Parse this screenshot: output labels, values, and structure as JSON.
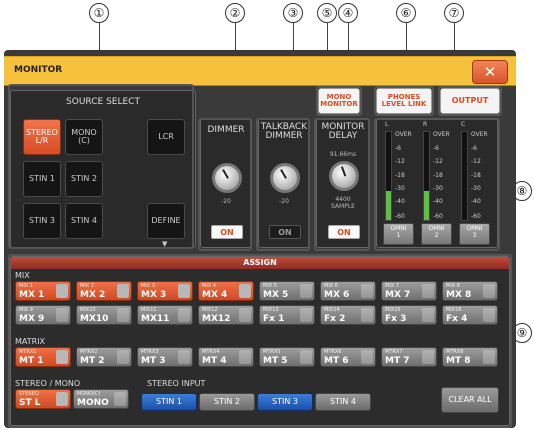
{
  "callouts": [
    "①",
    "②",
    "③",
    "⑤",
    "④",
    "⑥",
    "⑦",
    "⑧",
    "⑨"
  ],
  "window": {
    "title": "MONITOR",
    "close_symbol": "✕"
  },
  "source_select": {
    "title": "SOURCE SELECT",
    "buttons": [
      {
        "label": "STEREO L/R",
        "state": "on"
      },
      {
        "label": "MONO (C)",
        "state": "off"
      },
      {
        "label": "LCR",
        "state": "off"
      },
      {
        "label": "STIN 1",
        "state": "off"
      },
      {
        "label": "STIN 2",
        "state": "off"
      },
      {
        "label": "STIN 3",
        "state": "off"
      },
      {
        "label": "STIN 4",
        "state": "off"
      },
      {
        "label": "DEFINE",
        "state": "off"
      }
    ]
  },
  "dimmer": {
    "title": "DIMMER",
    "value": "-20",
    "on_label": "ON",
    "on": true
  },
  "talkback_dimmer": {
    "title": "TALKBACK DIMMER",
    "value": "-20",
    "on_label": "ON",
    "on": false
  },
  "monitor_delay": {
    "title": "MONITOR DELAY",
    "time": "91.66ms",
    "samples": "4400",
    "sample_unit": "SAMPLE",
    "on_label": "ON",
    "on": true
  },
  "top_buttons": {
    "mono_monitor": "MONO MONITOR",
    "phones_level_link": "PHONES LEVEL LINK",
    "output": "OUTPUT"
  },
  "meters": {
    "scale": [
      "OVER",
      "-6",
      "-12",
      "-18",
      "-30",
      "-40",
      "-60"
    ],
    "channels": [
      {
        "head": "L",
        "level": 0.33,
        "omni": "OMNI",
        "omni_num": "1"
      },
      {
        "head": "R",
        "level": 0.33,
        "omni": "OMNI",
        "omni_num": "2"
      },
      {
        "head": "C",
        "level": 0.0,
        "omni": "OMNI",
        "omni_num": "3"
      }
    ]
  },
  "assign": {
    "title": "ASSIGN",
    "mix_label": "MIX",
    "mix": [
      {
        "small": "MIX 1",
        "big": "MX 1",
        "on": true
      },
      {
        "small": "MIX 2",
        "big": "MX 2",
        "on": true
      },
      {
        "small": "MIX 3",
        "big": "MX 3",
        "on": true
      },
      {
        "small": "MIX 4",
        "big": "MX 4",
        "on": true
      },
      {
        "small": "MIX 5",
        "big": "MX 5",
        "on": false
      },
      {
        "small": "MIX 6",
        "big": "MX 6",
        "on": false
      },
      {
        "small": "MIX 7",
        "big": "MX 7",
        "on": false
      },
      {
        "small": "MIX 8",
        "big": "MX 8",
        "on": false
      },
      {
        "small": "MIX 9",
        "big": "MX 9",
        "on": false
      },
      {
        "small": "MIX10",
        "big": "MX10",
        "on": false
      },
      {
        "small": "MIX11",
        "big": "MX11",
        "on": false
      },
      {
        "small": "MIX12",
        "big": "MX12",
        "on": false
      },
      {
        "small": "MIX13",
        "big": "Fx 1",
        "on": false
      },
      {
        "small": "MIX14",
        "big": "Fx 2",
        "on": false
      },
      {
        "small": "MIX15",
        "big": "Fx 3",
        "on": false
      },
      {
        "small": "MIX16",
        "big": "Fx 4",
        "on": false
      }
    ],
    "matrix_label": "MATRIX",
    "matrix": [
      {
        "small": "MTRX1",
        "big": "MT 1",
        "on": true
      },
      {
        "small": "MTRX2",
        "big": "MT 2",
        "on": false
      },
      {
        "small": "MTRX3",
        "big": "MT 3",
        "on": false
      },
      {
        "small": "MTRX4",
        "big": "MT 4",
        "on": false
      },
      {
        "small": "MTRX5",
        "big": "MT 5",
        "on": false
      },
      {
        "small": "MTRX6",
        "big": "MT 6",
        "on": false
      },
      {
        "small": "MTRX7",
        "big": "MT 7",
        "on": false
      },
      {
        "small": "MTRX8",
        "big": "MT 8",
        "on": false
      }
    ],
    "stereo_mono_label": "STEREO / MONO",
    "stereo": {
      "small": "STEREO",
      "big": "ST L",
      "on": true
    },
    "mono": {
      "small": "MONO(C)",
      "big": "MONO",
      "on": false
    },
    "stereo_input_label": "STEREO INPUT",
    "stereo_inputs": [
      {
        "label": "STIN 1",
        "on": true
      },
      {
        "label": "STIN 2",
        "on": false
      },
      {
        "label": "STIN 3",
        "on": true
      },
      {
        "label": "STIN 4",
        "on": false
      }
    ],
    "clear_all": "CLEAR ALL"
  }
}
